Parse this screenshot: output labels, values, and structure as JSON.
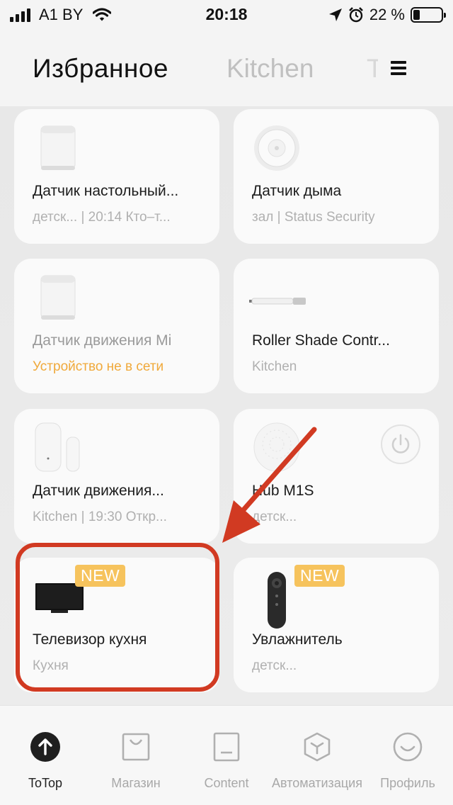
{
  "status_bar": {
    "carrier": "A1 BY",
    "time": "20:18",
    "battery": "22 %",
    "battery_level": 0.22
  },
  "header": {
    "tabs": [
      {
        "label": "Избранное",
        "active": true
      },
      {
        "label": "Kitchen",
        "active": false
      },
      {
        "label": "Т",
        "active": false
      }
    ]
  },
  "devices": [
    {
      "name": "Датчик настольный...",
      "subtitle": "детск... | 20:14 Кто–т...",
      "icon": "motion-sensor-icon"
    },
    {
      "name": "Датчик дыма",
      "subtitle": "зал | Status Security",
      "icon": "smoke-detector-icon"
    },
    {
      "name": "Датчик движения Mi",
      "subtitle": "Устройство не в сети",
      "icon": "motion-sensor-icon",
      "offline": true
    },
    {
      "name": " Roller Shade Contr...",
      "subtitle": "Kitchen",
      "icon": "roller-shade-icon"
    },
    {
      "name": "Датчик движения...",
      "subtitle": "Kitchen | 19:30 Откр...",
      "icon": "door-sensor-icon"
    },
    {
      "name": "Hub M1S",
      "subtitle": "детск...",
      "icon": "hub-icon",
      "power_button": true
    },
    {
      "name": "Телевизор кухня",
      "subtitle": "Кухня",
      "icon": "tv-icon",
      "badge": "NEW"
    },
    {
      "name": "Увлажнитель",
      "subtitle": "детск...",
      "icon": "remote-icon",
      "badge": "NEW"
    }
  ],
  "bottom_nav": [
    {
      "label": "ToTop",
      "icon": "arrow-up-icon",
      "active": true
    },
    {
      "label": "Магазин",
      "icon": "shopping-bag-icon"
    },
    {
      "label": "Content",
      "icon": "content-icon"
    },
    {
      "label": "Автоматизация",
      "icon": "automation-cube-icon"
    },
    {
      "label": "Профиль",
      "icon": "profile-smile-icon"
    }
  ],
  "colors": {
    "accent_warning": "#f0a93b",
    "badge": "#f6c35d",
    "annotation": "#d13a22"
  }
}
